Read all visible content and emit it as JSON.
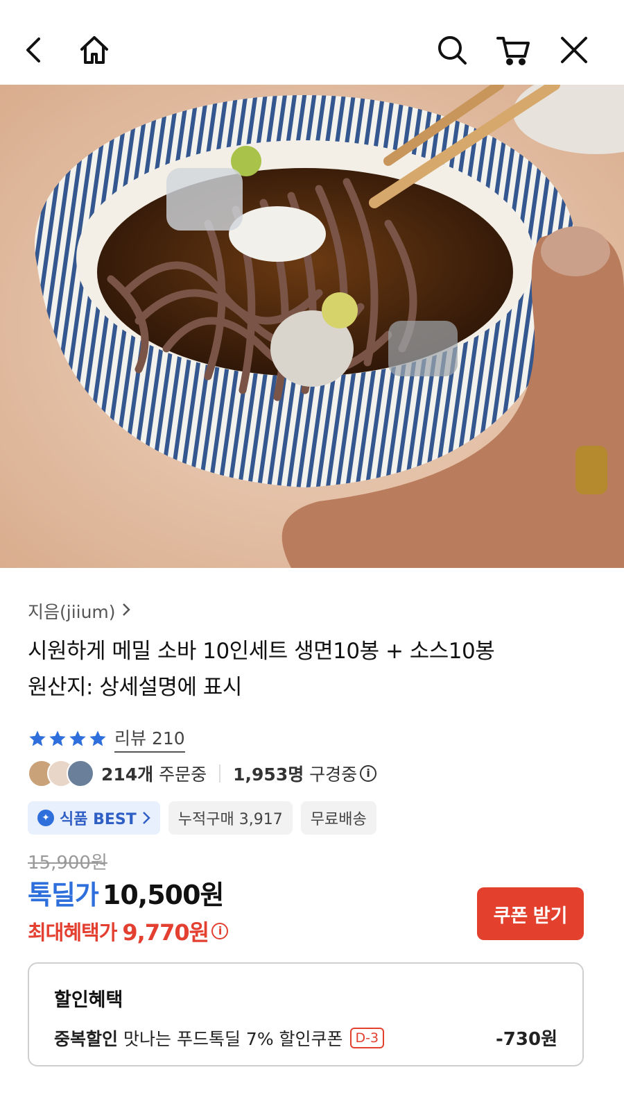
{
  "header": {
    "back_icon": "back-chevron-icon",
    "home_icon": "home-icon",
    "search_icon": "search-icon",
    "cart_icon": "cart-icon",
    "close_icon": "close-icon"
  },
  "product": {
    "seller": "지음(jiium)",
    "title_line1": "시원하게 메밀 소바 10인세트 생면10봉 + 소스10봉",
    "title_line2": "원산지: 상세설명에 표시",
    "rating_stars": 4,
    "review_label": "리뷰 210",
    "orders_count": "214개",
    "orders_suffix": " 주문중",
    "viewers_count": "1,953명",
    "viewers_suffix": " 구경중",
    "info_glyph": "i"
  },
  "tags": {
    "best": "식품 BEST",
    "cumulative": "누적구매 3,917",
    "shipping": "무료배송"
  },
  "pricing": {
    "original": "15,900원",
    "deal_label": "톡딜가",
    "deal_price": "10,500원",
    "max_label": "최대혜택가",
    "max_price": "9,770원",
    "coupon_button": "쿠폰 받기"
  },
  "benefit": {
    "title": "할인혜택",
    "kind": "중복할인",
    "description": "맛나는 푸드톡딜 7% 할인쿠폰",
    "dday": "D-3",
    "amount": "-730원"
  },
  "colors": {
    "accent_blue": "#2f6fdc",
    "accent_red": "#e3402e"
  }
}
